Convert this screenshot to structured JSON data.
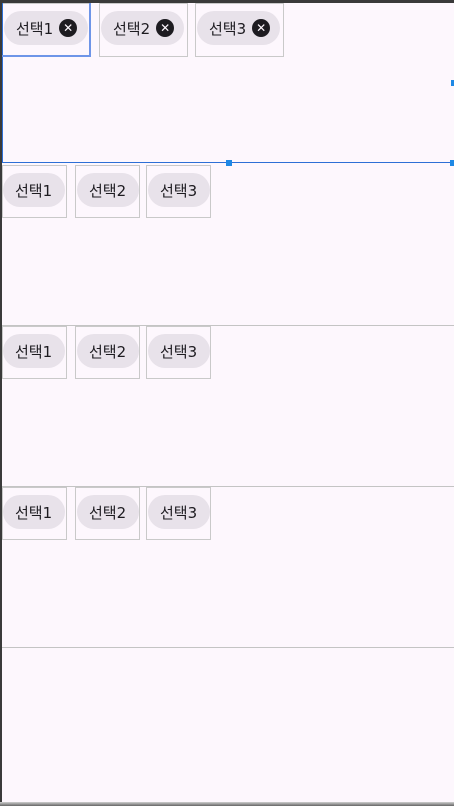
{
  "rows": [
    {
      "chips": [
        {
          "label": "선택1",
          "closable": true
        },
        {
          "label": "선택2",
          "closable": true
        },
        {
          "label": "선택3",
          "closable": true
        }
      ]
    },
    {
      "chips": [
        {
          "label": "선택1"
        },
        {
          "label": "선택2"
        },
        {
          "label": "선택3"
        }
      ]
    },
    {
      "chips": [
        {
          "label": "선택1"
        },
        {
          "label": "선택2"
        },
        {
          "label": "선택3"
        }
      ]
    },
    {
      "chips": [
        {
          "label": "선택1"
        },
        {
          "label": "선택2"
        },
        {
          "label": "선택3"
        }
      ]
    }
  ],
  "icons": {
    "close": "close-circle-icon"
  },
  "colors": {
    "background": "#fdf7fd",
    "chip": "#e8e2ea",
    "selection": "#1e88e5"
  }
}
